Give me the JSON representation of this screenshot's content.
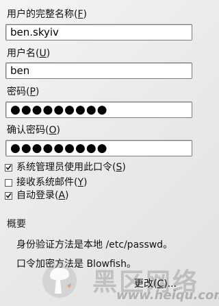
{
  "fullname": {
    "label": "用户的完整名称(",
    "accel": "F",
    "label_end": ")",
    "value": "ben.skyiv"
  },
  "username": {
    "label": "用户名(",
    "accel": "U",
    "label_end": ")",
    "value": "ben"
  },
  "password": {
    "label": "密码(",
    "accel": "P",
    "label_end": ")",
    "value": "●●●●●●●●●"
  },
  "confirm": {
    "label": "确认密码(",
    "accel": "O",
    "label_end": ")",
    "value": "●●●●●●●●●"
  },
  "checkboxes": [
    {
      "label": "系统管理员使用此口令(",
      "accel": "S",
      "label_end": ")",
      "checked": true
    },
    {
      "label": "接收系统邮件(",
      "accel": "Y",
      "label_end": ")",
      "checked": false
    },
    {
      "label": "自动登录(",
      "accel": "A",
      "label_end": ")",
      "checked": true
    }
  ],
  "summary": {
    "title": "概要",
    "line1": "身份验证方法是本地 /etc/passwd。",
    "line2": "口令加密方法是 Blowfish。"
  },
  "change_button": {
    "label": "更改(",
    "accel": "C",
    "label_end": ")..."
  },
  "watermark": {
    "text": "黑区网络",
    "url": "www.heiqu.com"
  }
}
